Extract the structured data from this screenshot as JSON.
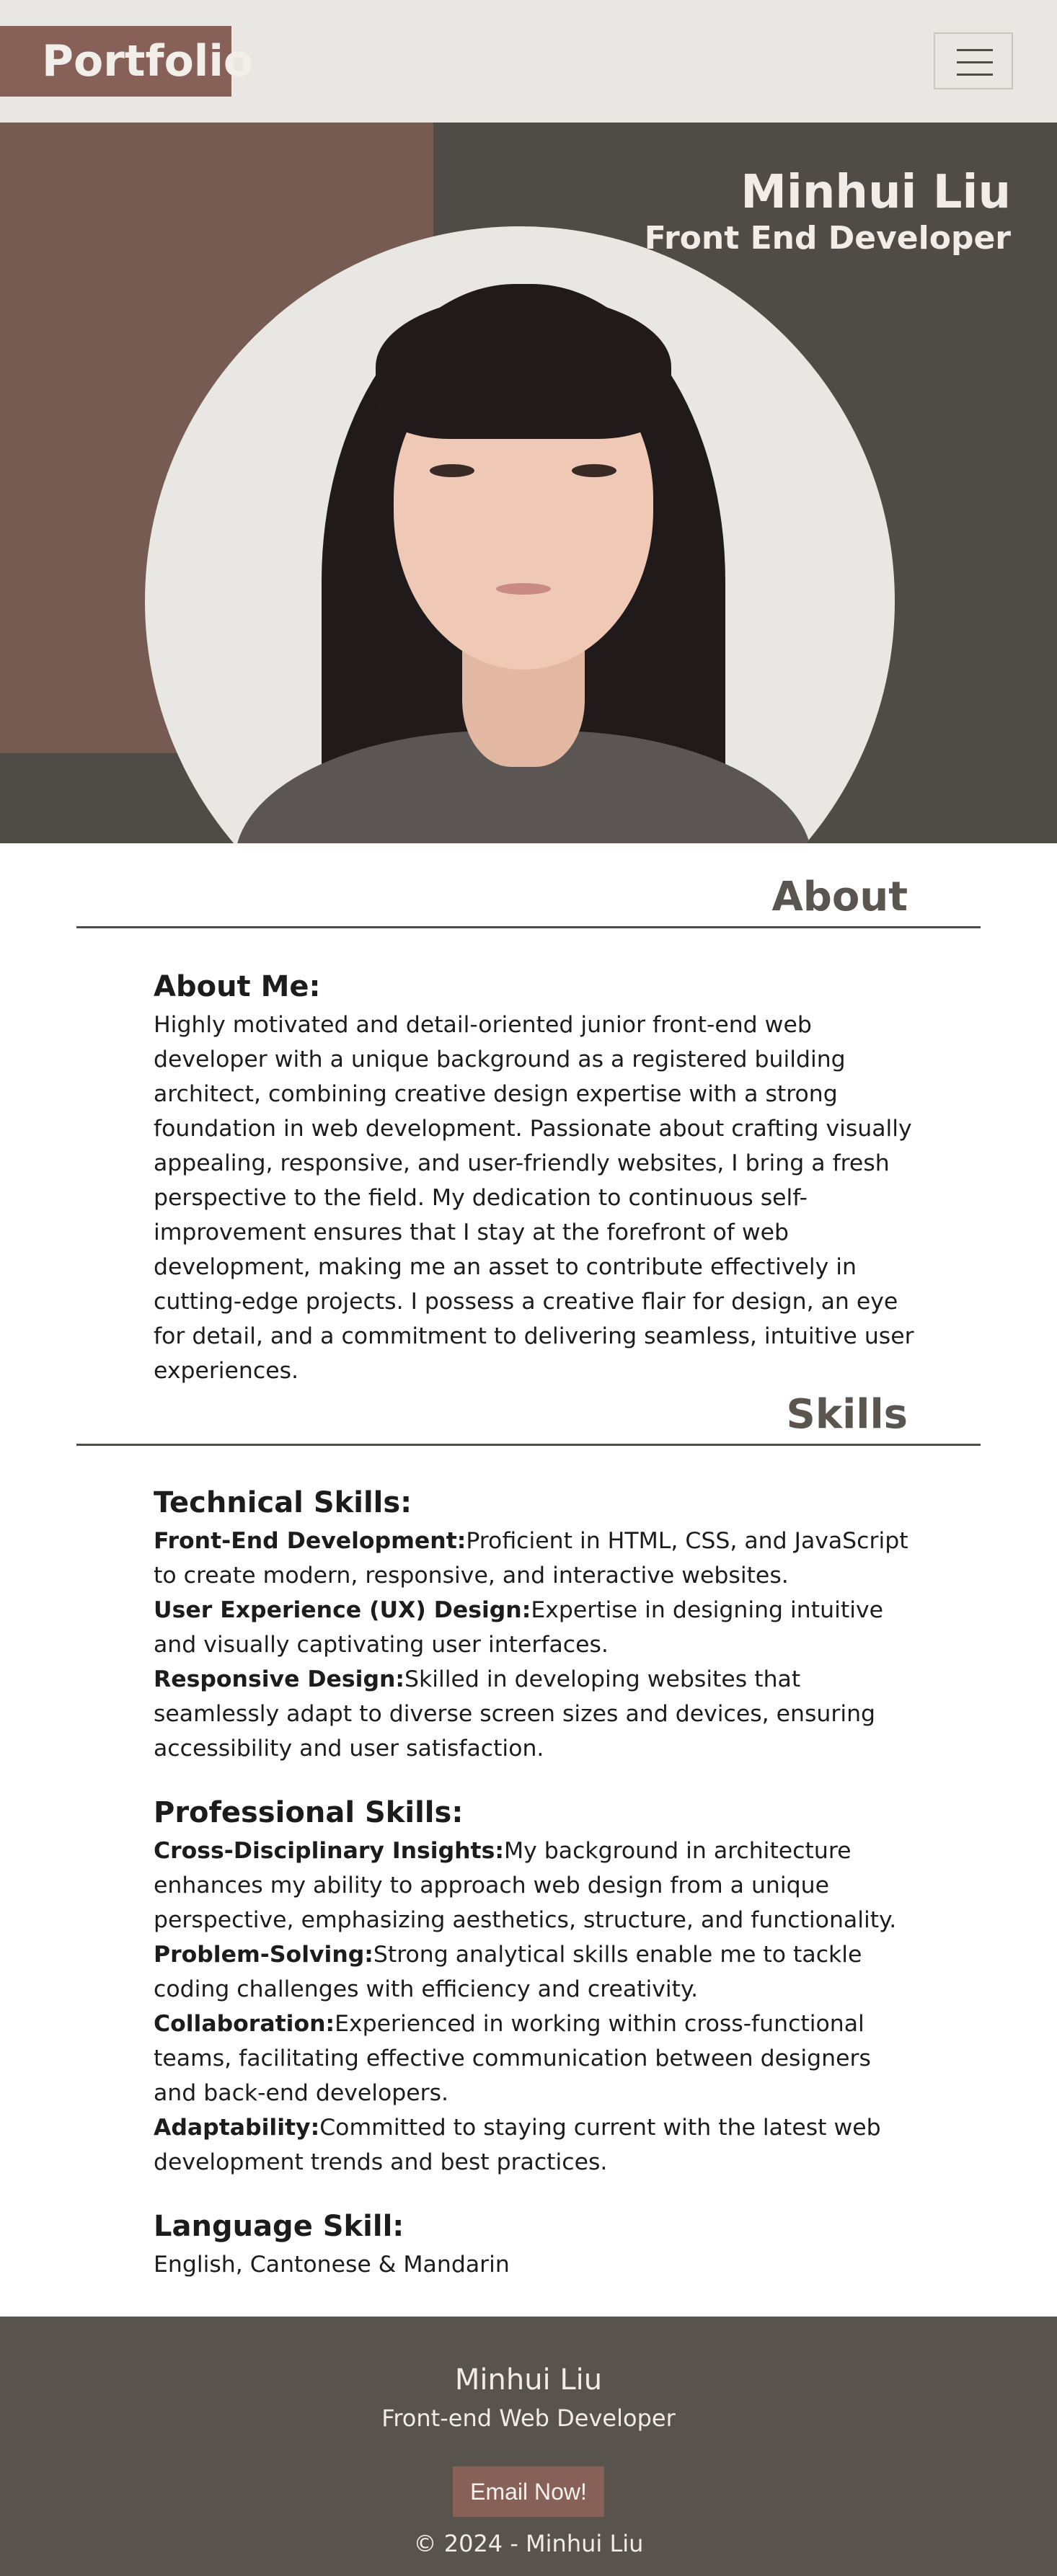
{
  "header": {
    "logo": "Portfolio",
    "menu_icon": "hamburger-menu-icon"
  },
  "hero": {
    "name": "Minhui Liu",
    "role": "Front End Developer",
    "photo": "profile-photo"
  },
  "about": {
    "title": "About",
    "heading": "About Me:",
    "text": "Highly motivated and detail-oriented junior front-end web developer with a unique background as a registered building architect, combining creative design expertise with a strong foundation in web development. Passionate about crafting visually appealing, responsive, and user-friendly websites, I bring a fresh perspective to the field. My dedication to continuous self-improvement ensures that I stay at the forefront of web development, making me an asset to contribute effectively in cutting-edge projects. I possess a creative flair for design, an eye for detail, and a commitment to delivering seamless, intuitive user experiences."
  },
  "skills": {
    "title": "Skills",
    "technical": {
      "heading": "Technical Skills:",
      "items": [
        {
          "label": "Front-End Development:",
          "text": "Proficient in HTML, CSS, and JavaScript to create modern, responsive, and interactive websites."
        },
        {
          "label": "User Experience (UX) Design:",
          "text": "Expertise in designing intuitive and visually captivating user interfaces."
        },
        {
          "label": "Responsive Design:",
          "text": "Skilled in developing websites that seamlessly adapt to diverse screen sizes and devices, ensuring accessibility and user satisfaction."
        }
      ]
    },
    "professional": {
      "heading": "Professional Skills:",
      "items": [
        {
          "label": "Cross-Disciplinary Insights:",
          "text": "My background in architecture enhances my ability to approach web design from a unique perspective, emphasizing aesthetics, structure, and functionality."
        },
        {
          "label": "Problem-Solving:",
          "text": "Strong analytical skills enable me to tackle coding challenges with efficiency and creativity."
        },
        {
          "label": "Collaboration:",
          "text": "Experienced in working within cross-functional teams, facilitating effective communication between designers and back-end developers."
        },
        {
          "label": "Adaptability:",
          "text": "Committed to staying current with the latest web development trends and best practices."
        }
      ]
    },
    "language": {
      "heading": "Language Skill:",
      "text": "English, Cantonese & Mandarin"
    }
  },
  "footer": {
    "name": "Minhui Liu",
    "role": "Front-end Web Developer",
    "email_button": "Email Now!",
    "copyright": "© 2024 - Minhui Liu"
  },
  "colors": {
    "header_bg": "#e9e7e3",
    "brand": "#876158",
    "hero_bg": "#4f4b46",
    "hero_accent": "#765b53",
    "footer_bg": "#58534d",
    "title_text": "#5a554e"
  }
}
